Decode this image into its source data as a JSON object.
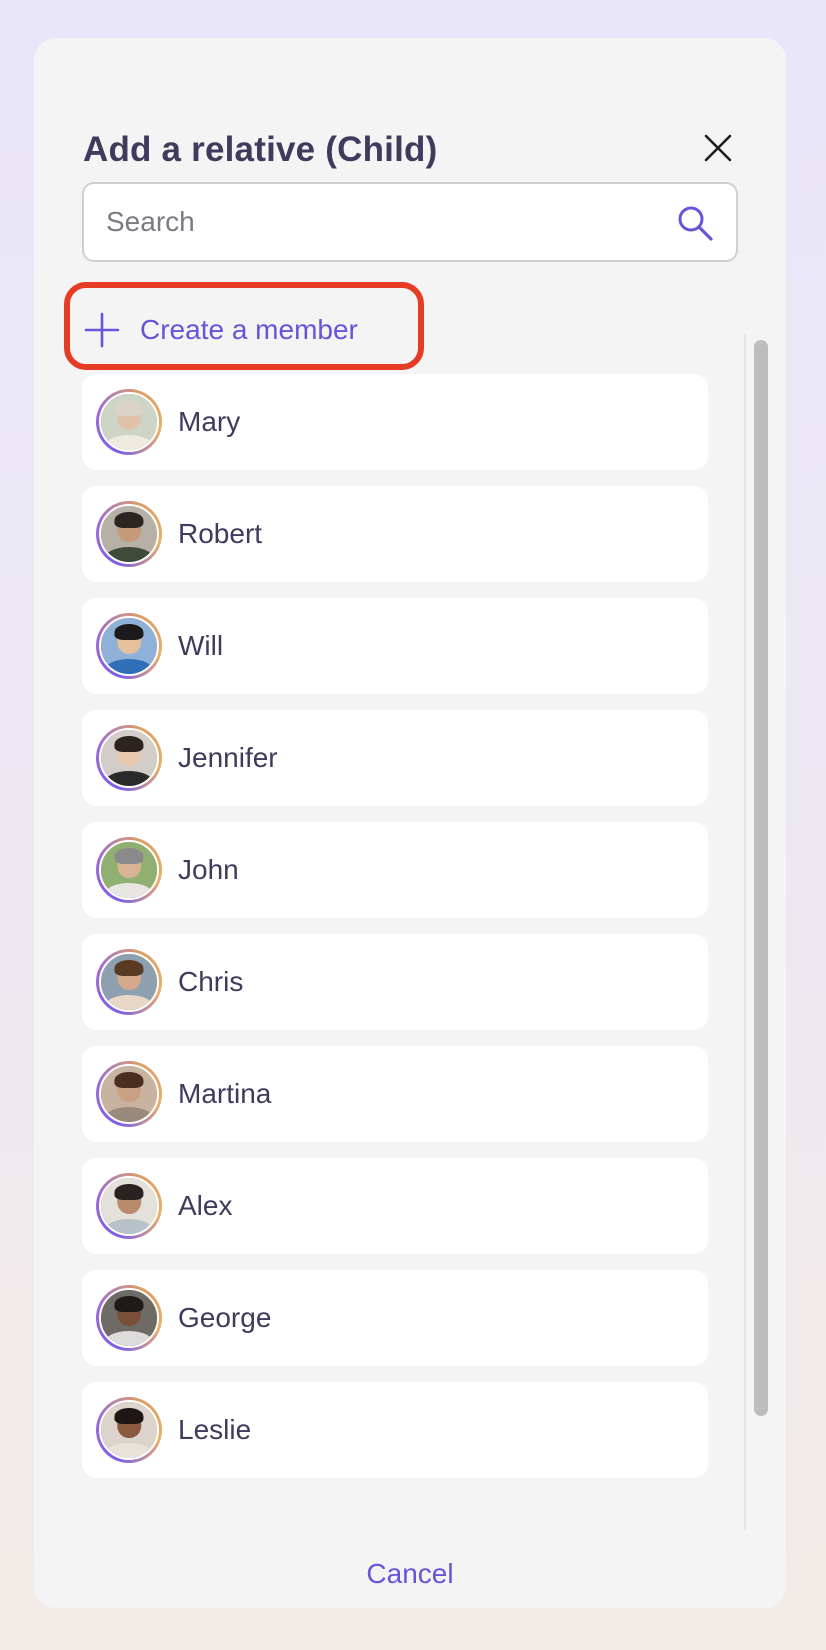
{
  "dialog": {
    "title": "Add a relative (Child)",
    "close_icon": "close-icon"
  },
  "search": {
    "placeholder": "Search",
    "value": "",
    "icon": "search-icon"
  },
  "create_member": {
    "label": "Create a member",
    "icon": "plus-icon"
  },
  "members": [
    {
      "name": "Mary"
    },
    {
      "name": "Robert"
    },
    {
      "name": "Will"
    },
    {
      "name": "Jennifer"
    },
    {
      "name": "John"
    },
    {
      "name": "Chris"
    },
    {
      "name": "Martina"
    },
    {
      "name": "Alex"
    },
    {
      "name": "George"
    },
    {
      "name": "Leslie"
    }
  ],
  "footer": {
    "cancel_label": "Cancel"
  },
  "colors": {
    "accent": "#6a52d9",
    "highlight": "#e63b24",
    "text": "#3f3b5c"
  }
}
